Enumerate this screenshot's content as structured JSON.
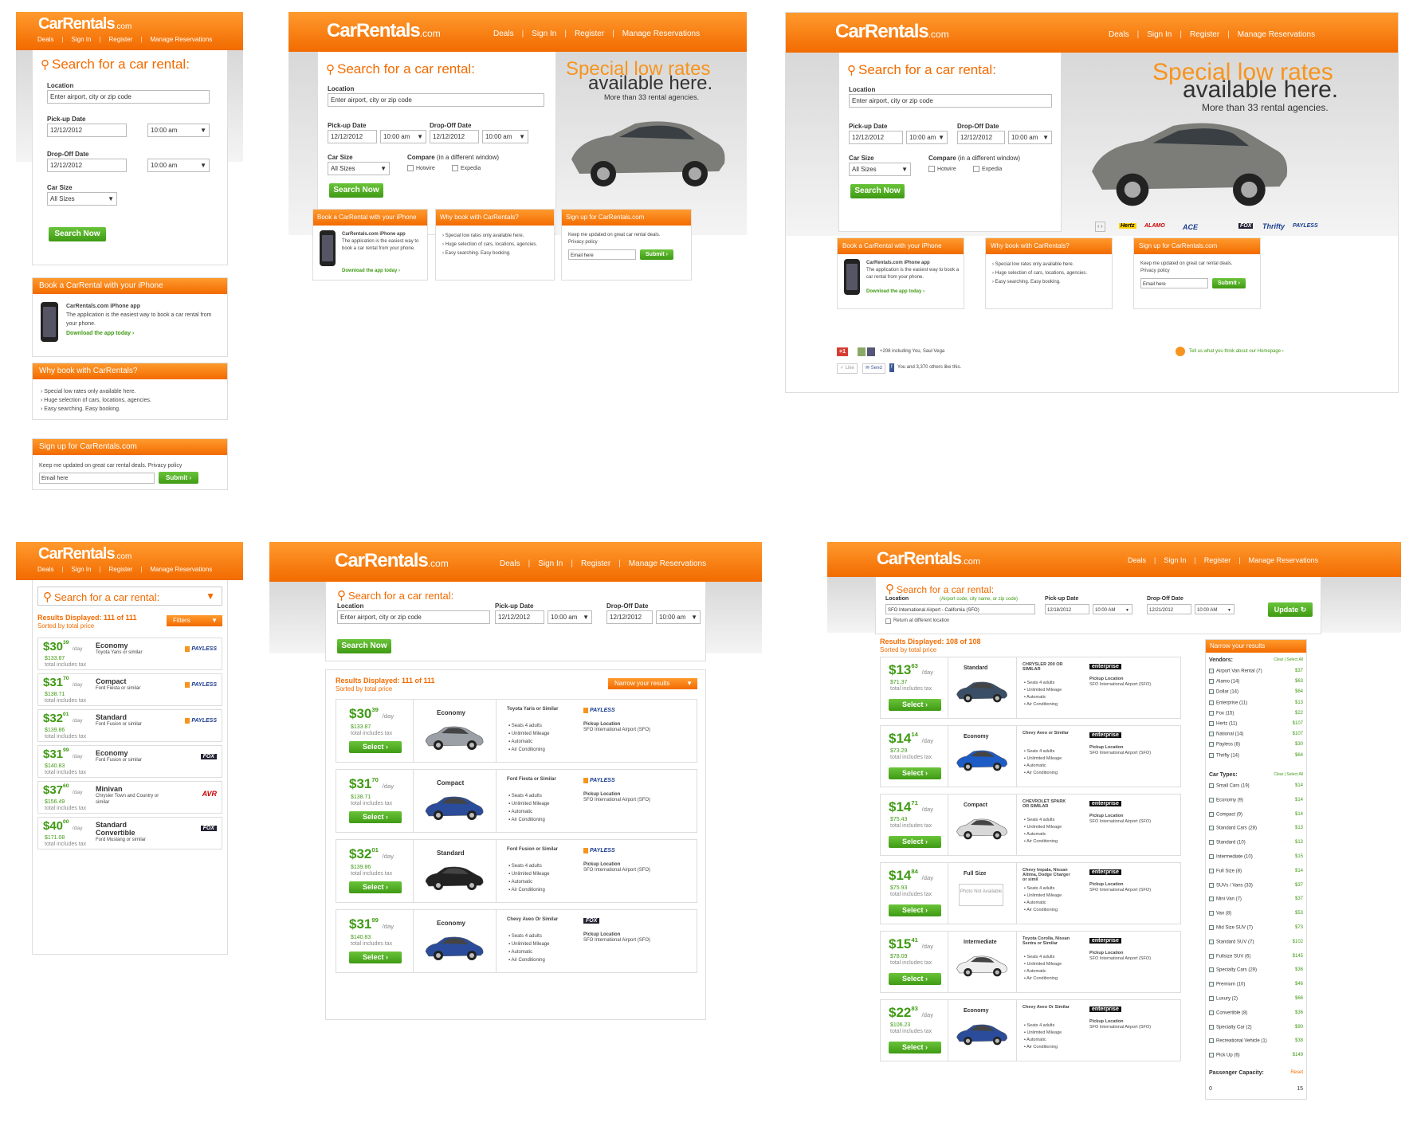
{
  "brand": {
    "name": "CarRentals",
    "domain": ".com",
    "accent": "#f26b00",
    "green": "#3f9a14"
  },
  "nav": [
    "Deals",
    "Sign In",
    "Register",
    "Manage Reservations"
  ],
  "search": {
    "title": "Search for a car rental:",
    "location_label": "Location",
    "location_placeholder": "Enter airport, city or zip code",
    "pickup_label": "Pick-up Date",
    "dropoff_label": "Drop-Off Date",
    "pickup_date": "12/12/2012",
    "dropoff_date": "12/12/2012",
    "time": "10:00 am",
    "carsize_label": "Car Size",
    "carsize_value": "All Sizes",
    "compare_label": "Compare",
    "compare_note": "(in a different window)",
    "compare_options": [
      "Hotwire",
      "Expedia"
    ],
    "button": "Search Now",
    "hint": "(Airport code, city name, or zip code)",
    "location_value": "SFO International Airport - California (SFO)",
    "return_different": "Return at different location",
    "pickup2": "12/18/2012",
    "dropoff2": "12/21/2012",
    "time2": "10:00 AM",
    "update": "Update"
  },
  "promo": {
    "line1": "Special low rates",
    "line2": "available here.",
    "line3": "More than 33 rental agencies."
  },
  "boxes": {
    "iphone_title": "Book a CarRental with your iPhone",
    "iphone_app": "CarRentals.com iPhone app",
    "iphone_desc": "The application is the easiest way to book a car rental from your phone.",
    "iphone_link": "Download the app today ›",
    "why_title": "Why book with CarRentals?",
    "why_items": [
      "Special low rates only available here.",
      "Huge selection of cars, locations, agencies.",
      "Easy searching. Easy booking."
    ],
    "signup_title": "Sign up for CarRentals.com",
    "signup_desc": "Keep me updated on great car rental deals. Privacy policy",
    "email_placeholder": "Email here",
    "submit": "Submit ›"
  },
  "agencies": [
    "Hertz",
    "ALAMO",
    "ACE",
    "FOX",
    "Thrifty",
    "PAYLESS"
  ],
  "social": {
    "plus": "+1",
    "plus_text": "+208 including You, Saul Vega",
    "like": "Like",
    "send": "Send",
    "fb_text": "You and 3,370 others like this.",
    "feedback": "Tell us what you think about our Homepage ›"
  },
  "results": {
    "title": "Results Displayed: 111 of 111",
    "title2": "Results Displayed: 108 of 108",
    "sorted": "Sorted by total price",
    "filters": "Filters",
    "narrow": "Narrow your results",
    "select": "Select",
    "day": "/day",
    "total_note": "total includes tax",
    "pickup_loc_label": "Pickup Location",
    "pickup_loc": "SFO International Airport (SFO)",
    "features": [
      "Seats 4 adults",
      "Unlimited Mileage",
      "Automatic",
      "Air Conditioning"
    ],
    "mobile": [
      {
        "dollars": "$30",
        "cents": "39",
        "total": "$133.87",
        "cls": "Economy",
        "model": "Toyota Yaris or similar",
        "agency": "PAYLESS"
      },
      {
        "dollars": "$31",
        "cents": "70",
        "total": "$138.71",
        "cls": "Compact",
        "model": "Ford Fiesta or similar",
        "agency": "PAYLESS"
      },
      {
        "dollars": "$32",
        "cents": "01",
        "total": "$139.86",
        "cls": "Standard",
        "model": "Ford Fusion or similar",
        "agency": "PAYLESS"
      },
      {
        "dollars": "$31",
        "cents": "99",
        "total": "$140.83",
        "cls": "Economy",
        "model": "Ford Fusion or similar",
        "agency": "FOX"
      },
      {
        "dollars": "$37",
        "cents": "60",
        "total": "$156.49",
        "cls": "Minivan",
        "model": "Chrysler Town and Country or similar",
        "agency": "AVR"
      },
      {
        "dollars": "$40",
        "cents": "00",
        "total": "$171.08",
        "cls": "Standard Convertible",
        "model": "Ford Mustang or similar",
        "agency": "FOX"
      }
    ],
    "tablet": [
      {
        "dollars": "$30",
        "cents": "39",
        "total": "$133.87",
        "cls": "Economy",
        "model": "Toyota Yaris or Similar",
        "agency": "PAYLESS",
        "color": "#9aa0a6"
      },
      {
        "dollars": "$31",
        "cents": "70",
        "total": "$138.71",
        "cls": "Compact",
        "model": "Ford Fiesta or Similar",
        "agency": "PAYLESS",
        "color": "#2a4c9a"
      },
      {
        "dollars": "$32",
        "cents": "01",
        "total": "$139.86",
        "cls": "Standard",
        "model": "Ford Fusion or Similar",
        "agency": "PAYLESS",
        "color": "#222"
      },
      {
        "dollars": "$31",
        "cents": "99",
        "total": "$140.83",
        "cls": "Economy",
        "model": "Chevy Aveo Or Similar",
        "agency": "FOX",
        "color": "#2a4c9a"
      }
    ],
    "desktop": [
      {
        "dollars": "$13",
        "cents": "63",
        "total": "$71.37",
        "cls": "Standard",
        "model": "CHRYSLER 200 OR SIMILAR",
        "color": "#3a4e66"
      },
      {
        "dollars": "$14",
        "cents": "14",
        "total": "$73.29",
        "cls": "Economy",
        "model": "Chevy Aveo or Similar",
        "color": "#1d5bc6"
      },
      {
        "dollars": "$14",
        "cents": "71",
        "total": "$75.43",
        "cls": "Compact",
        "model": "CHEVROLET SPARK OR SIMILAR",
        "color": "#d8d8d8"
      },
      {
        "dollars": "$14",
        "cents": "84",
        "total": "$75.93",
        "cls": "Full Size",
        "model": "Chevy Impala, Nissan Altima, Dodge Charger or simil",
        "color": "none"
      },
      {
        "dollars": "$15",
        "cents": "41",
        "total": "$78.09",
        "cls": "Intermediate",
        "model": "Toyota Corolla, Nissan Sentra or Similar",
        "color": "#eee"
      },
      {
        "dollars": "$22",
        "cents": "83",
        "total": "$106.23",
        "cls": "Economy",
        "model": "Chevy Aveo Or Similar",
        "color": "#2a4c9a"
      }
    ],
    "photo_na": "Photo Not Available",
    "enterprise": "enterprise",
    "vendors_label": "Vendors:",
    "cartypes_label": "Car Types:",
    "clear_all": "Clear | Select All",
    "vendors": [
      {
        "n": "Airport Van Rental (7)",
        "v": "$37"
      },
      {
        "n": "Alamo (14)",
        "v": "$63"
      },
      {
        "n": "Dollar (14)",
        "v": "$64"
      },
      {
        "n": "Enterprise (11)",
        "v": "$13"
      },
      {
        "n": "Fox (15)",
        "v": "$22"
      },
      {
        "n": "Hertz (11)",
        "v": "$107"
      },
      {
        "n": "National (14)",
        "v": "$107"
      },
      {
        "n": "Payless (8)",
        "v": "$30"
      },
      {
        "n": "Thrifty (14)",
        "v": "$64"
      }
    ],
    "cartypes": [
      {
        "n": "Small Cars (19)",
        "v": "$14"
      },
      {
        "n": "Economy (9)",
        "v": "$14"
      },
      {
        "n": "Compact (9)",
        "v": "$14"
      },
      {
        "n": "Standard Cars (28)",
        "v": "$13"
      },
      {
        "n": "Standard (10)",
        "v": "$13"
      },
      {
        "n": "Intermediate (10)",
        "v": "$15"
      },
      {
        "n": "Full Size (8)",
        "v": "$14"
      },
      {
        "n": "SUVs / Vans (33)",
        "v": "$37"
      },
      {
        "n": "Mini Van (7)",
        "v": "$37"
      },
      {
        "n": "Van (8)",
        "v": "$53"
      },
      {
        "n": "Mid Size SUV (7)",
        "v": "$73"
      },
      {
        "n": "Standard SUV (7)",
        "v": "$102"
      },
      {
        "n": "Fullsize SUV (6)",
        "v": "$145"
      },
      {
        "n": "Specialty Cars (29)",
        "v": "$36"
      },
      {
        "n": "Premium (10)",
        "v": "$46"
      },
      {
        "n": "Luxury (2)",
        "v": "$66"
      },
      {
        "n": "Convertible (8)",
        "v": "$36"
      },
      {
        "n": "Specialty Car (2)",
        "v": "$90"
      },
      {
        "n": "Recreational Vehicle (1)",
        "v": "$38"
      },
      {
        "n": "Pick Up (6)",
        "v": "$149"
      }
    ],
    "passenger_label": "Passenger Capacity:",
    "reset": "Reset",
    "pass_min": "0",
    "pass_max": "15"
  }
}
